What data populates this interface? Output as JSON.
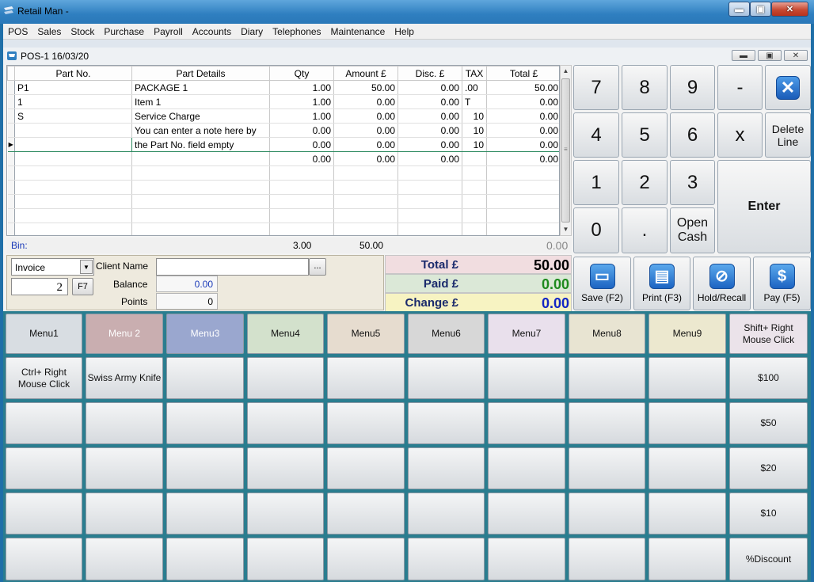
{
  "window": {
    "title": "Retail Man -",
    "min_glyph": "▬",
    "max_glyph": "▣",
    "close_glyph": "✕"
  },
  "menu": [
    "POS",
    "Sales",
    "Stock",
    "Purchase",
    "Payroll",
    "Accounts",
    "Diary",
    "Telephones",
    "Maintenance",
    "Help"
  ],
  "child": {
    "title": "POS-1   16/03/20"
  },
  "grid": {
    "columns": [
      "Part No.",
      "Part Details",
      "Qty",
      "Amount £",
      "Disc. £",
      "TAX",
      "Total £"
    ],
    "rows": [
      [
        "P1",
        "PACKAGE 1",
        "1.00",
        "50.00",
        "0.00",
        ".00",
        "50.00"
      ],
      [
        "1",
        "Item 1",
        "1.00",
        "0.00",
        "0.00",
        "T",
        "0.00"
      ],
      [
        "S",
        "Service Charge",
        "1.00",
        "0.00",
        "0.00",
        "10",
        "0.00"
      ],
      [
        "",
        "You can enter a note here by",
        "0.00",
        "0.00",
        "0.00",
        "10",
        "0.00"
      ],
      [
        "",
        "the Part No. field empty",
        "0.00",
        "0.00",
        "0.00",
        "10",
        "0.00"
      ],
      [
        "",
        "",
        "0.00",
        "0.00",
        "0.00",
        "",
        "0.00"
      ]
    ],
    "selected_row": 4,
    "indicator": "▶",
    "bin_label": "Bin:",
    "total_qty": "3.00",
    "total_amount": "50.00",
    "total_value": "0.00"
  },
  "client": {
    "doc_type": "Invoice",
    "doc_number": "2",
    "f7": "F7",
    "client_name_label": "Client Name",
    "client_name_value": "",
    "ellipsis": "...",
    "balance_label": "Balance",
    "balance_value": "0.00",
    "points_label": "Points",
    "points_value": "0"
  },
  "summary": {
    "total_label": "Total £",
    "total_value": "50.00",
    "paid_label": "Paid £",
    "paid_value": "0.00",
    "change_label": "Change £",
    "change_value": "0.00",
    "colors": {
      "total_bg": "#f1dde0",
      "paid_bg": "#dbe8d7",
      "change_bg": "#f7f3c2",
      "paid_value": "#1e8a1e",
      "change_value": "#1226c4"
    }
  },
  "keypad": {
    "keys": [
      "7",
      "8",
      "9",
      "-",
      "4",
      "5",
      "6",
      "x",
      "1",
      "2",
      "3",
      "0",
      "."
    ],
    "open_cash_1": "Open",
    "open_cash_2": "Cash",
    "delete_line_1": "Delete",
    "delete_line_2": "Line",
    "clear_icon": "close-icon",
    "enter": "Enter"
  },
  "actions": [
    {
      "label": "Save (F2)",
      "icon": "card-icon"
    },
    {
      "label": "Print (F3)",
      "icon": "printer-icon"
    },
    {
      "label": "Hold/Recall",
      "icon": "paperclip-icon"
    },
    {
      "label": "Pay (F5)",
      "icon": "dollar-icon"
    }
  ],
  "menus": {
    "top_row": [
      "Menu1",
      "Menu 2",
      "Menu3",
      "Menu4",
      "Menu5",
      "Menu6",
      "Menu7",
      "Menu8",
      "Menu9"
    ],
    "top_colors": [
      "#d8dde2",
      "#c9aeb0",
      "#9aa7cf",
      "#d3e1cc",
      "#e6dccf",
      "#d7d7d7",
      "#e9e0ec",
      "#e8e4d2",
      "#ece8cf"
    ],
    "top_text_colors": [
      "#111",
      "#ffffff",
      "#ffffff",
      "#111",
      "#111",
      "#111",
      "#111",
      "#111",
      "#111"
    ],
    "shift_click_1": "Shift+ Right",
    "shift_click_2": "Mouse Click",
    "ctrl_click_1": "Ctrl+ Right",
    "ctrl_click_2": "Mouse Click",
    "swiss": "Swiss Army Knife",
    "cash": [
      "$100",
      "$50",
      "$20",
      "$10",
      "%Discount"
    ]
  }
}
